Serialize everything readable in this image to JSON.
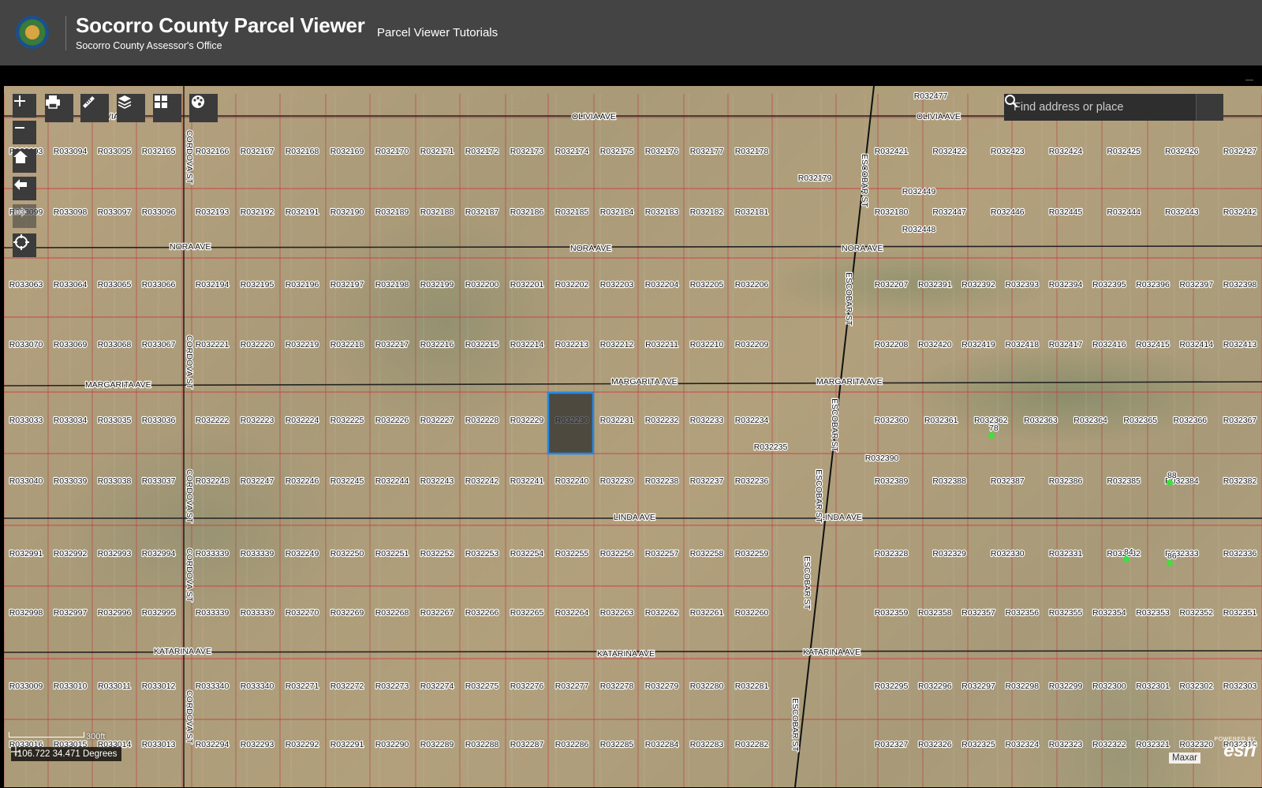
{
  "header": {
    "title": "Socorro County Parcel Viewer",
    "subtitle": "Socorro County Assessor's Office",
    "nav_links": [
      "Parcel Viewer Tutorials"
    ]
  },
  "search": {
    "placeholder": "Find address or place"
  },
  "map": {
    "streets_horizontal": [
      "OLIVIA AVE",
      "NORA AVE",
      "MARGARITA AVE",
      "LINDA AVE",
      "KATARINA AVE"
    ],
    "streets_vertical": [
      "CORDOVA ST",
      "ESCOBAR ST"
    ],
    "selected_parcel": "R032230",
    "scale_label": "300ft",
    "coordinates": "-106.722 34.471 Degrees",
    "attribution": "Maxar",
    "esri_powered": "POWERED BY",
    "esri_word": "esri",
    "house_numbers": [
      "78",
      "88",
      "84",
      "86"
    ],
    "parcel_rows": [
      [
        "R033093",
        "R033094",
        "R033095",
        "R032165",
        "R032166",
        "R032167",
        "R032168",
        "R032169",
        "R032170",
        "R032171",
        "R032172",
        "R032173",
        "R032174",
        "R032175",
        "R032176",
        "R032177",
        "R032178",
        "R032421",
        "R032422",
        "R032423",
        "R032424",
        "R032425",
        "R032426",
        "R032427"
      ],
      [
        "R033099",
        "R033098",
        "R033097",
        "R033096",
        "R032193",
        "R032192",
        "R032191",
        "R032190",
        "R032189",
        "R032188",
        "R032187",
        "R032186",
        "R032185",
        "R032184",
        "R032183",
        "R032182",
        "R032181",
        "R032180",
        "R032447",
        "R032446",
        "R032445",
        "R032444",
        "R032443",
        "R032442"
      ],
      [
        "R033063",
        "R033064",
        "R033065",
        "R033066",
        "R032194",
        "R032195",
        "R032196",
        "R032197",
        "R032198",
        "R032199",
        "R032200",
        "R032201",
        "R032202",
        "R032203",
        "R032204",
        "R032205",
        "R032206",
        "R032207",
        "R032391",
        "R032392",
        "R032393",
        "R032394",
        "R032395",
        "R032396",
        "R032397",
        "R032398"
      ],
      [
        "R033070",
        "R033069",
        "R033068",
        "R033067",
        "R032221",
        "R032220",
        "R032219",
        "R032218",
        "R032217",
        "R032216",
        "R032215",
        "R032214",
        "R032213",
        "R032212",
        "R032211",
        "R032210",
        "R032209",
        "R032208",
        "R032420",
        "R032419",
        "R032418",
        "R032417",
        "R032416",
        "R032415",
        "R032414",
        "R032413"
      ],
      [
        "R033033",
        "R033034",
        "R033035",
        "R033036",
        "R032222",
        "R032223",
        "R032224",
        "R032225",
        "R032226",
        "R032227",
        "R032228",
        "R032229",
        "R032230",
        "R032231",
        "R032232",
        "R032233",
        "R032234",
        "R032360",
        "R032361",
        "R032362",
        "R032363",
        "R032364",
        "R032365",
        "R032366",
        "R032367"
      ],
      [
        "R033040",
        "R033039",
        "R033038",
        "R033037",
        "R032248",
        "R032247",
        "R032246",
        "R032245",
        "R032244",
        "R032243",
        "R032242",
        "R032241",
        "R032240",
        "R032239",
        "R032238",
        "R032237",
        "R032236",
        "R032389",
        "R032388",
        "R032387",
        "R032386",
        "R032385",
        "R032384",
        "R032382"
      ],
      [
        "R032991",
        "R032992",
        "R032993",
        "R032994",
        "R033339",
        "R033339",
        "R032249",
        "R032250",
        "R032251",
        "R032252",
        "R032253",
        "R032254",
        "R032255",
        "R032256",
        "R032257",
        "R032258",
        "R032259",
        "R032328",
        "R032329",
        "R032330",
        "R032331",
        "R032332",
        "R032333",
        "R032336"
      ],
      [
        "R032998",
        "R032997",
        "R032996",
        "R032995",
        "R033339",
        "R033339",
        "R032270",
        "R032269",
        "R032268",
        "R032267",
        "R032266",
        "R032265",
        "R032264",
        "R032263",
        "R032262",
        "R032261",
        "R032260",
        "R032359",
        "R032358",
        "R032357",
        "R032356",
        "R032355",
        "R032354",
        "R032353",
        "R032352",
        "R032351"
      ],
      [
        "R033009",
        "R033010",
        "R033011",
        "R033012",
        "R033340",
        "R033340",
        "R032271",
        "R032272",
        "R032273",
        "R032274",
        "R032275",
        "R032276",
        "R032277",
        "R032278",
        "R032279",
        "R032280",
        "R032281",
        "R032295",
        "R032296",
        "R032297",
        "R032298",
        "R032299",
        "R032300",
        "R032301",
        "R032302",
        "R032303"
      ],
      [
        "R033016",
        "R033015",
        "R033014",
        "R033013",
        "R032294",
        "R032293",
        "R032292",
        "R032291",
        "R032290",
        "R032289",
        "R032288",
        "R032287",
        "R032286",
        "R032285",
        "R032284",
        "R032283",
        "R032282",
        "R032327",
        "R032326",
        "R032325",
        "R032324",
        "R032323",
        "R032322",
        "R032321",
        "R032320",
        "R032319"
      ]
    ],
    "extra_parcels": [
      "R032477",
      "R032179",
      "R032449",
      "R032448",
      "R032235",
      "R032390"
    ]
  }
}
